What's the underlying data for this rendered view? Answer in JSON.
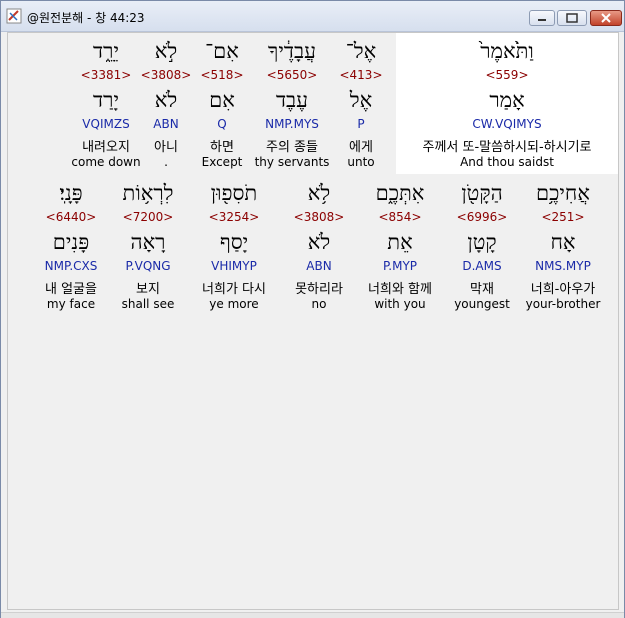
{
  "window": {
    "title": "@원전분해 - 창 44:23"
  },
  "row1": [
    {
      "heb": "יֵרֵ֑ד",
      "strong": "<3381>",
      "lemma": "יָרַד",
      "morph": "VQIMZS",
      "kor": "내려오지",
      "eng": "come down"
    },
    {
      "heb": "לֹ֣א",
      "strong": "<3808>",
      "lemma": "לֹא",
      "morph": "ABN",
      "kor": "아니",
      "eng": "."
    },
    {
      "heb": "אִם־",
      "strong": "<518>",
      "lemma": "אִם",
      "morph": "Q",
      "kor": "하면",
      "eng": "Except"
    },
    {
      "heb": "עֲבָדֶ֔יךָ",
      "strong": "<5650>",
      "lemma": "עֶבֶד",
      "morph": "NMP.MYS",
      "kor": "주의 종들",
      "eng": "thy servants"
    },
    {
      "heb": "אֶל־",
      "strong": "<413>",
      "lemma": "אֶל",
      "morph": "P",
      "kor": "에게",
      "eng": "unto"
    },
    {
      "heb": "וַתֹּ֙אמֶר֙",
      "strong": "<559>",
      "lemma": "אָמַר",
      "morph": "CW.VQIMYS",
      "kor": "주께서 또-말씀하시되-하시기로",
      "eng": "And thou saidst"
    }
  ],
  "row2": [
    {
      "heb": "פָּנָֽי׃",
      "strong": "<6440>",
      "lemma": "פָּנִים",
      "morph": "NMP.CXS",
      "kor": "내 얼굴을",
      "eng": "my face"
    },
    {
      "heb": "לִרְא֥וֹת",
      "strong": "<7200>",
      "lemma": "רָאָה",
      "morph": "P.VQNG",
      "kor": "보지",
      "eng": "shall see"
    },
    {
      "heb": "תֹסִפ֖וּן",
      "strong": "<3254>",
      "lemma": "יָסַף",
      "morph": "VHIMYP",
      "kor": "너희가 다시",
      "eng": "ye more"
    },
    {
      "heb": "לֹ֥א",
      "strong": "<3808>",
      "lemma": "לֹא",
      "morph": "ABN",
      "kor": "못하리라",
      "eng": "no"
    },
    {
      "heb": "אִתְּכֶ֑ם",
      "strong": "<854>",
      "lemma": "אֵת",
      "morph": "P.MYP",
      "kor": "너희와 함께",
      "eng": "with you"
    },
    {
      "heb": "הַקָּטֹ֖ן",
      "strong": "<6996>",
      "lemma": "קָטָן",
      "morph": "D.AMS",
      "kor": "막재",
      "eng": "youngest"
    },
    {
      "heb": "אֲחִיכֶ֥ם",
      "strong": "<251>",
      "lemma": "אָח",
      "morph": "NMS.MYP",
      "kor": "너희-아우가",
      "eng": "your-brother"
    }
  ],
  "colors": {
    "strong": "#8b0000",
    "morph": "#1a2aa8",
    "highlight": "#ffffff"
  }
}
